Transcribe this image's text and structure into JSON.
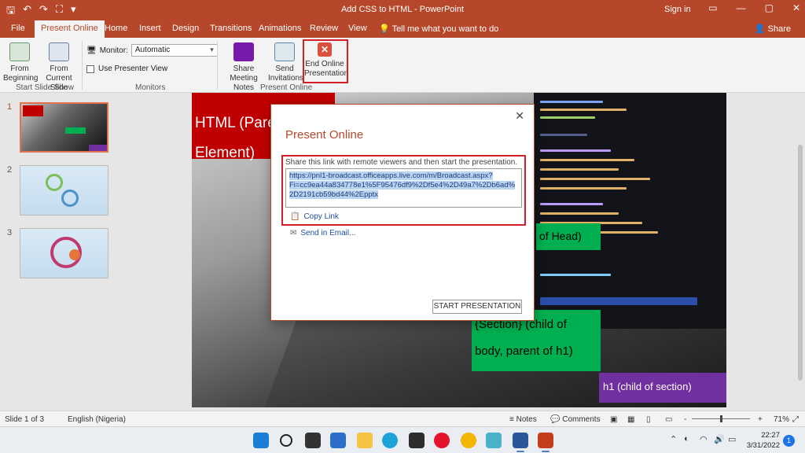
{
  "titlebar": {
    "title": "Add CSS to HTML  -  PowerPoint",
    "signin": "Sign in",
    "qa_icons": [
      "save-icon",
      "undo-icon",
      "redo-icon",
      "start-from-beginning-icon",
      "customize-qa-icon"
    ],
    "qa_glyphs": [
      "🖫",
      "↶",
      "↷",
      "⛶",
      "▾"
    ],
    "window_glyphs": [
      "▭",
      "—",
      "▢",
      "✕"
    ]
  },
  "tabs": [
    "File",
    "Present Online",
    "Home",
    "Insert",
    "Design",
    "Transitions",
    "Animations",
    "Review",
    "View"
  ],
  "active_tab": "Present Online",
  "tellme": "Tell me what you want to do",
  "share": "Share",
  "ribbon": {
    "from_beginning": "From Beginning",
    "from_current": "From Current Slide",
    "start_group": "Start Slide Show",
    "monitor_label": "Monitor:",
    "monitor_value": "Automatic",
    "presenter_view": "Use Presenter View",
    "monitors_group": "Monitors",
    "share_notes": "Share Meeting Notes",
    "send_invitations": "Send Invitations",
    "end_online": "End Online Presentation",
    "present_group": "Present Online"
  },
  "slides": [
    {
      "num": "1",
      "active": true
    },
    {
      "num": "2",
      "active": false
    },
    {
      "num": "3",
      "active": false
    }
  ],
  "slide_text": {
    "red_line1": "HTML (Pare",
    "red_line2": "Element)",
    "green1": "of Head)",
    "green2_line1": "{Section} (child of",
    "green2_line2": "body, parent of h1)",
    "purple": "h1 (child of section)"
  },
  "dialog": {
    "title": "Present Online",
    "description": "Share this link with remote viewers and then start the presentation.",
    "link": "https://pnl1-broadcast.officeapps.live.com/m/Broadcast.aspx?Fi=cc9ea44a834778e1%5F95476df9%2Df5e4%2D49a7%2Db6ad%2D2191cb59bd44%2Epptx",
    "link_line1": "https://pnl1-broadcast.officeapps.live.com/m/Broadcast.aspx?",
    "link_line2": "Fi=cc9ea44a834778e1%5F95476df9%2Df5e4%2D49a7%2Db6ad%",
    "link_line3": "2D2191cb59bd44%2Epptx",
    "copy_link": "Copy Link",
    "send_email": "Send in Email...",
    "start_button": "START PRESENTATION",
    "close": "✕"
  },
  "status": {
    "slide": "Slide 1 of 3",
    "language": "English (Nigeria)",
    "notes": "Notes",
    "comments": "Comments",
    "zoom_minus": "-",
    "zoom_plus": "+",
    "zoom": "71%"
  },
  "taskbar": {
    "apps": [
      "windows-start-icon",
      "search-icon",
      "task-view-icon",
      "widgets-icon",
      "file-explorer-icon",
      "edge-icon",
      "store-icon",
      "opera-icon",
      "chrome-icon",
      "app-icon",
      "word-icon",
      "powerpoint-icon"
    ],
    "time": "22:27",
    "date": "3/31/2022",
    "notifications": "1"
  },
  "colors": {
    "accent": "#b7472a",
    "highlight_red": "#d31f27",
    "slide_red": "#c00000",
    "slide_green": "#00b050",
    "slide_purple": "#7030a0"
  }
}
